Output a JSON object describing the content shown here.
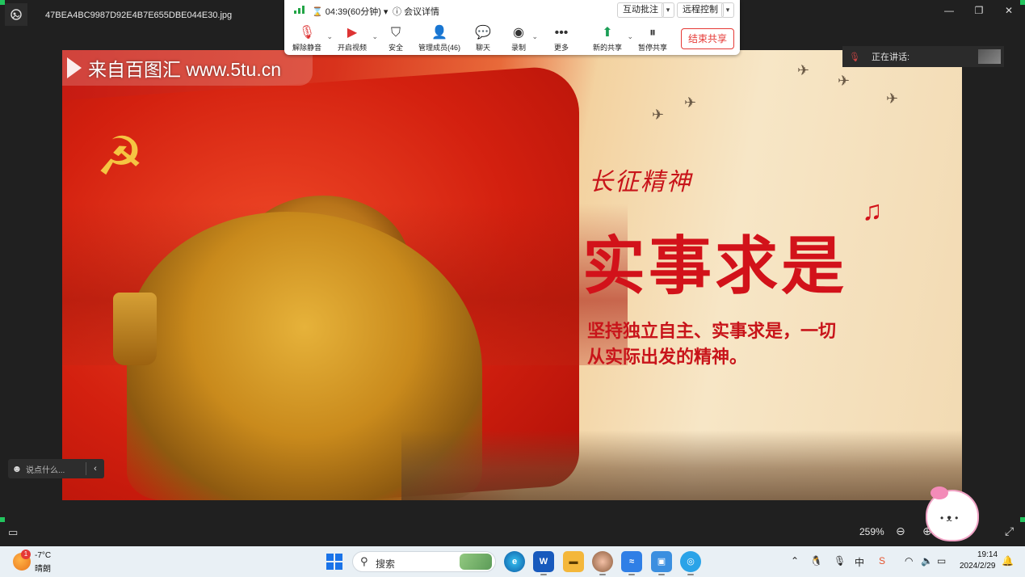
{
  "viewer": {
    "file_name": "47BEA4BC9987D92E4B7E655DBE044E30.jpg",
    "minimize_glyph": "—",
    "restore_glyph": "❐",
    "close_glyph": "✕",
    "zoom_level": "259%"
  },
  "image": {
    "watermark": "来自百图汇 www.5tu.cn",
    "script_title": "长征精神",
    "main_title": "实事求是",
    "description_line1": "坚持独立自主、实事求是，一切",
    "description_line2": "从实际出发的精神。"
  },
  "meeting": {
    "timer": "04:39(60分钟)",
    "info_label": "会议详情",
    "annotate_label": "互动批注",
    "remote_label": "远程控制",
    "tools": [
      {
        "label": "解除静音",
        "icon": "mic-off-icon"
      },
      {
        "label": "开启视频",
        "icon": "video-off-icon"
      },
      {
        "label": "安全",
        "icon": "shield-icon"
      },
      {
        "label": "管理成员(46)",
        "icon": "members-icon"
      },
      {
        "label": "聊天",
        "icon": "chat-icon"
      },
      {
        "label": "录制",
        "icon": "record-icon"
      },
      {
        "label": "更多",
        "icon": "more-icon"
      },
      {
        "label": "新的共享",
        "icon": "share-icon"
      },
      {
        "label": "暂停共享",
        "icon": "pause-icon"
      }
    ],
    "end_share_label": "结束共享",
    "speaking_label": "正在讲话:",
    "chat_placeholder": "说点什么..."
  },
  "taskbar": {
    "temperature": "-7°C",
    "condition": "晴朗",
    "weather_badge": "1",
    "search_label": "搜索",
    "ime_label": "中",
    "time": "19:14",
    "date": "2024/2/29"
  },
  "colors": {
    "accent_red": "#d2121a",
    "meeting_end": "#e53935",
    "signal_green": "#22a546"
  }
}
